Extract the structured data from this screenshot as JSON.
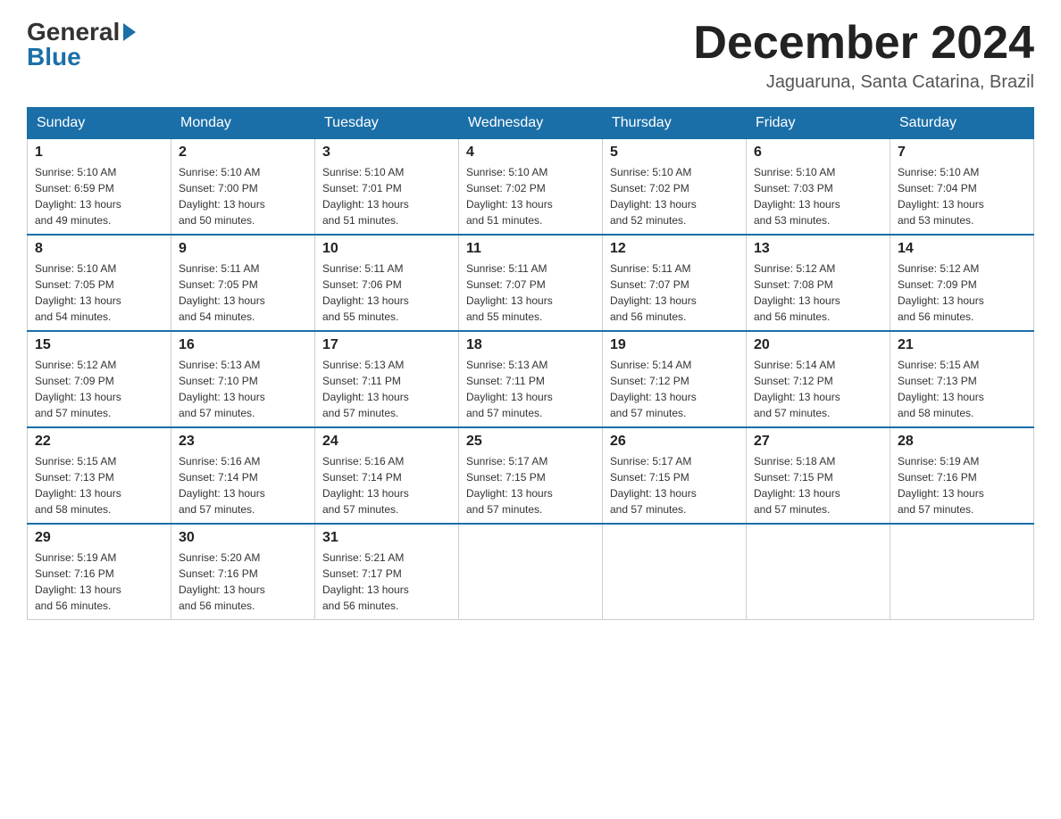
{
  "header": {
    "logo_general": "General",
    "logo_blue": "Blue",
    "title": "December 2024",
    "location": "Jaguaruna, Santa Catarina, Brazil"
  },
  "days_of_week": [
    "Sunday",
    "Monday",
    "Tuesday",
    "Wednesday",
    "Thursday",
    "Friday",
    "Saturday"
  ],
  "weeks": [
    [
      {
        "day": "1",
        "sunrise": "5:10 AM",
        "sunset": "6:59 PM",
        "daylight": "13 hours and 49 minutes."
      },
      {
        "day": "2",
        "sunrise": "5:10 AM",
        "sunset": "7:00 PM",
        "daylight": "13 hours and 50 minutes."
      },
      {
        "day": "3",
        "sunrise": "5:10 AM",
        "sunset": "7:01 PM",
        "daylight": "13 hours and 51 minutes."
      },
      {
        "day": "4",
        "sunrise": "5:10 AM",
        "sunset": "7:02 PM",
        "daylight": "13 hours and 51 minutes."
      },
      {
        "day": "5",
        "sunrise": "5:10 AM",
        "sunset": "7:02 PM",
        "daylight": "13 hours and 52 minutes."
      },
      {
        "day": "6",
        "sunrise": "5:10 AM",
        "sunset": "7:03 PM",
        "daylight": "13 hours and 53 minutes."
      },
      {
        "day": "7",
        "sunrise": "5:10 AM",
        "sunset": "7:04 PM",
        "daylight": "13 hours and 53 minutes."
      }
    ],
    [
      {
        "day": "8",
        "sunrise": "5:10 AM",
        "sunset": "7:05 PM",
        "daylight": "13 hours and 54 minutes."
      },
      {
        "day": "9",
        "sunrise": "5:11 AM",
        "sunset": "7:05 PM",
        "daylight": "13 hours and 54 minutes."
      },
      {
        "day": "10",
        "sunrise": "5:11 AM",
        "sunset": "7:06 PM",
        "daylight": "13 hours and 55 minutes."
      },
      {
        "day": "11",
        "sunrise": "5:11 AM",
        "sunset": "7:07 PM",
        "daylight": "13 hours and 55 minutes."
      },
      {
        "day": "12",
        "sunrise": "5:11 AM",
        "sunset": "7:07 PM",
        "daylight": "13 hours and 56 minutes."
      },
      {
        "day": "13",
        "sunrise": "5:12 AM",
        "sunset": "7:08 PM",
        "daylight": "13 hours and 56 minutes."
      },
      {
        "day": "14",
        "sunrise": "5:12 AM",
        "sunset": "7:09 PM",
        "daylight": "13 hours and 56 minutes."
      }
    ],
    [
      {
        "day": "15",
        "sunrise": "5:12 AM",
        "sunset": "7:09 PM",
        "daylight": "13 hours and 57 minutes."
      },
      {
        "day": "16",
        "sunrise": "5:13 AM",
        "sunset": "7:10 PM",
        "daylight": "13 hours and 57 minutes."
      },
      {
        "day": "17",
        "sunrise": "5:13 AM",
        "sunset": "7:11 PM",
        "daylight": "13 hours and 57 minutes."
      },
      {
        "day": "18",
        "sunrise": "5:13 AM",
        "sunset": "7:11 PM",
        "daylight": "13 hours and 57 minutes."
      },
      {
        "day": "19",
        "sunrise": "5:14 AM",
        "sunset": "7:12 PM",
        "daylight": "13 hours and 57 minutes."
      },
      {
        "day": "20",
        "sunrise": "5:14 AM",
        "sunset": "7:12 PM",
        "daylight": "13 hours and 57 minutes."
      },
      {
        "day": "21",
        "sunrise": "5:15 AM",
        "sunset": "7:13 PM",
        "daylight": "13 hours and 58 minutes."
      }
    ],
    [
      {
        "day": "22",
        "sunrise": "5:15 AM",
        "sunset": "7:13 PM",
        "daylight": "13 hours and 58 minutes."
      },
      {
        "day": "23",
        "sunrise": "5:16 AM",
        "sunset": "7:14 PM",
        "daylight": "13 hours and 57 minutes."
      },
      {
        "day": "24",
        "sunrise": "5:16 AM",
        "sunset": "7:14 PM",
        "daylight": "13 hours and 57 minutes."
      },
      {
        "day": "25",
        "sunrise": "5:17 AM",
        "sunset": "7:15 PM",
        "daylight": "13 hours and 57 minutes."
      },
      {
        "day": "26",
        "sunrise": "5:17 AM",
        "sunset": "7:15 PM",
        "daylight": "13 hours and 57 minutes."
      },
      {
        "day": "27",
        "sunrise": "5:18 AM",
        "sunset": "7:15 PM",
        "daylight": "13 hours and 57 minutes."
      },
      {
        "day": "28",
        "sunrise": "5:19 AM",
        "sunset": "7:16 PM",
        "daylight": "13 hours and 57 minutes."
      }
    ],
    [
      {
        "day": "29",
        "sunrise": "5:19 AM",
        "sunset": "7:16 PM",
        "daylight": "13 hours and 56 minutes."
      },
      {
        "day": "30",
        "sunrise": "5:20 AM",
        "sunset": "7:16 PM",
        "daylight": "13 hours and 56 minutes."
      },
      {
        "day": "31",
        "sunrise": "5:21 AM",
        "sunset": "7:17 PM",
        "daylight": "13 hours and 56 minutes."
      },
      null,
      null,
      null,
      null
    ]
  ],
  "labels": {
    "sunrise": "Sunrise:",
    "sunset": "Sunset:",
    "daylight": "Daylight:"
  }
}
